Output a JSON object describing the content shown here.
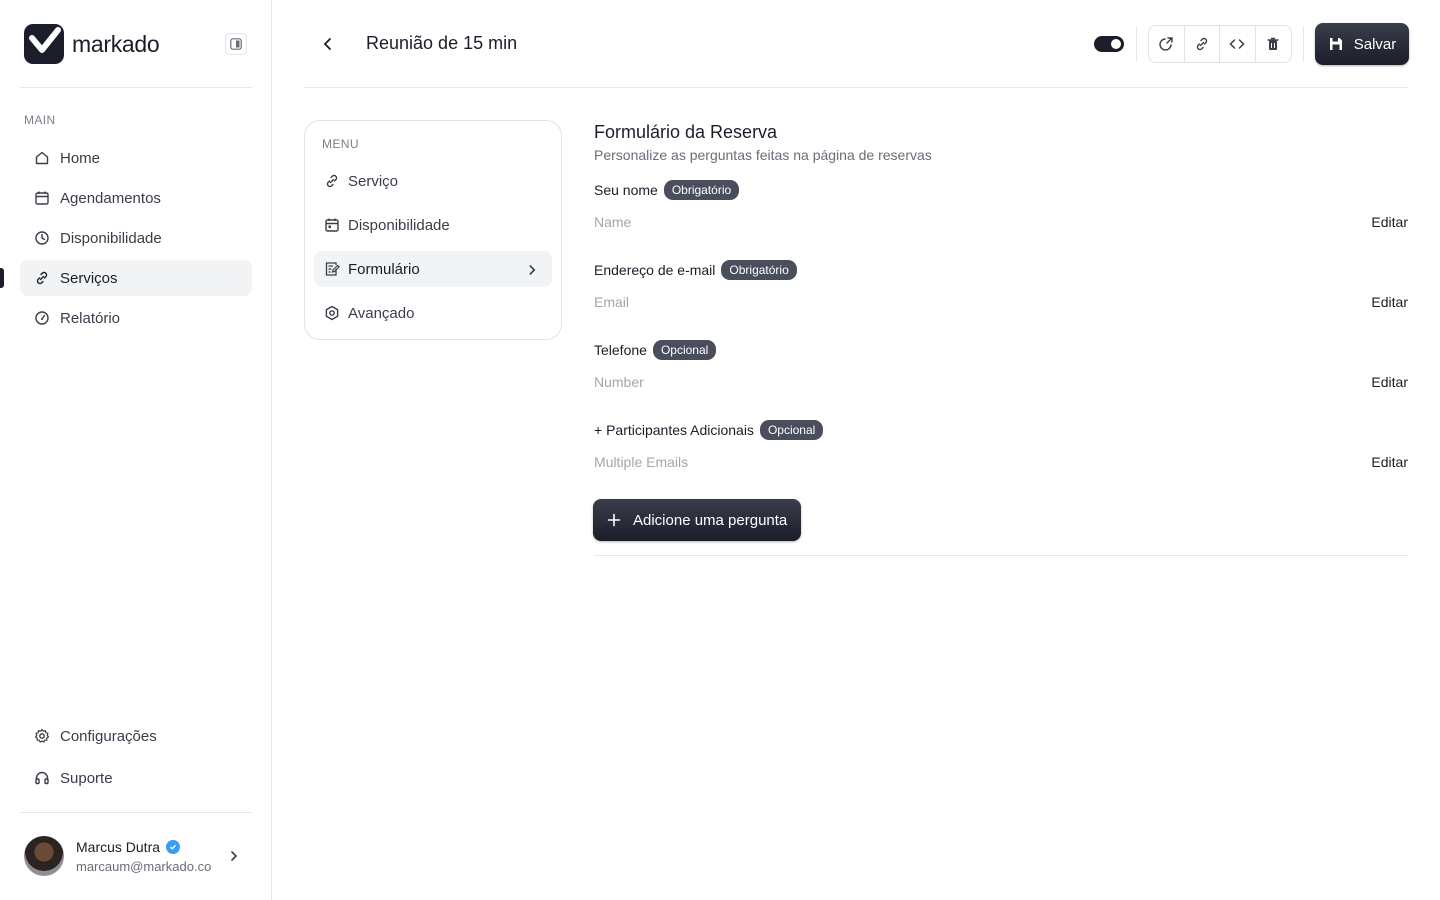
{
  "brand": {
    "name": "markado"
  },
  "sidebar": {
    "section_label": "MAIN",
    "items": [
      {
        "label": "Home",
        "icon": "home-icon"
      },
      {
        "label": "Agendamentos",
        "icon": "calendar-icon"
      },
      {
        "label": "Disponibilidade",
        "icon": "clock-icon"
      },
      {
        "label": "Serviços",
        "icon": "link-icon",
        "active": true
      },
      {
        "label": "Relatório",
        "icon": "gauge-icon"
      }
    ],
    "bottom_items": [
      {
        "label": "Configurações",
        "icon": "gear-icon"
      },
      {
        "label": "Suporte",
        "icon": "headphones-icon"
      }
    ],
    "user": {
      "name": "Marcus Dutra",
      "email": "marcaum@markado.co"
    }
  },
  "header": {
    "title": "Reunião de 15 min",
    "save_label": "Salvar"
  },
  "menu": {
    "label": "MENU",
    "items": [
      {
        "label": "Serviço",
        "icon": "link-icon"
      },
      {
        "label": "Disponibilidade",
        "icon": "calendar-icon"
      },
      {
        "label": "Formulário",
        "icon": "form-icon",
        "active": true
      },
      {
        "label": "Avançado",
        "icon": "settings-hex-icon"
      }
    ]
  },
  "form": {
    "title": "Formulário da Reserva",
    "subtitle": "Personalize as perguntas feitas na página de reservas",
    "fields": [
      {
        "label": "Seu nome",
        "badge": "Obrigatório",
        "placeholder": "Name",
        "action": "Editar"
      },
      {
        "label": "Endereço de e-mail",
        "badge": "Obrigatório",
        "placeholder": "Email",
        "action": "Editar"
      },
      {
        "label": "Telefone",
        "badge": "Opcional",
        "placeholder": "Number",
        "action": "Editar"
      },
      {
        "label": "+ Participantes Adicionais",
        "badge": "Opcional",
        "placeholder": "Multiple Emails",
        "action": "Editar"
      }
    ],
    "add_button": "Adicione uma pergunta"
  },
  "colors": {
    "primary": "#1b1d2a",
    "badge": "#4a4d5c",
    "verified": "#3b9cf2",
    "muted": "#a3a6ae"
  }
}
